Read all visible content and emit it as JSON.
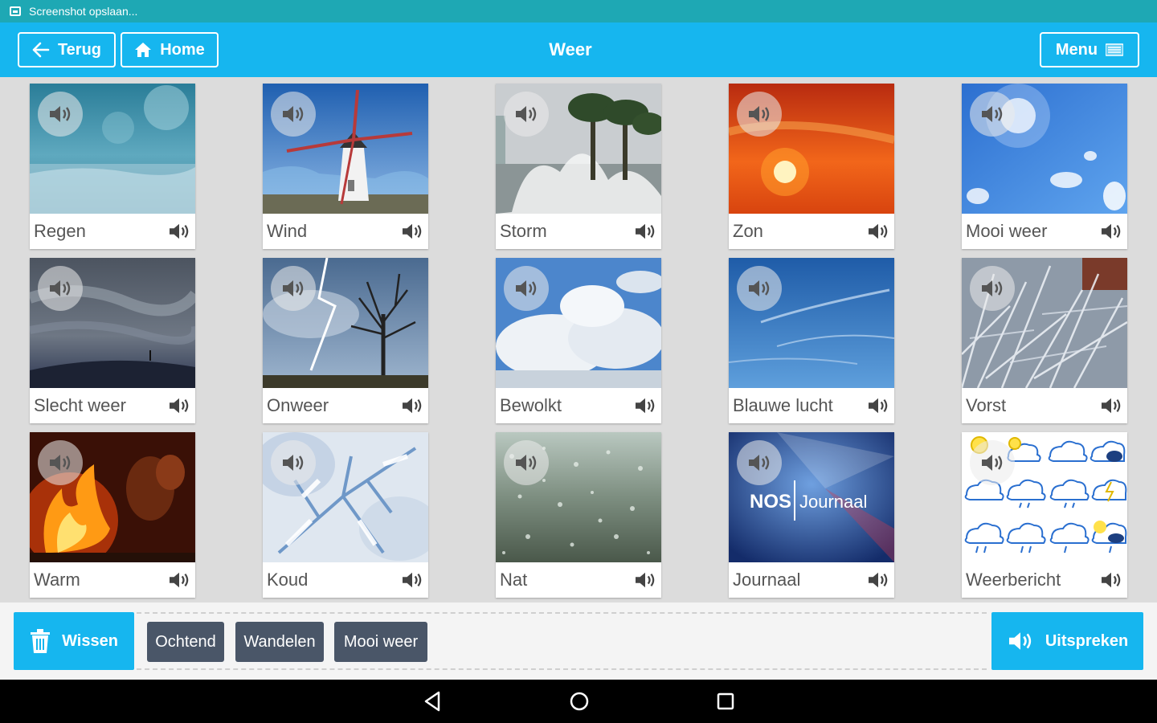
{
  "status_bar": {
    "notification": "Screenshot opslaan..."
  },
  "toolbar": {
    "back_label": "Terug",
    "home_label": "Home",
    "title": "Weer",
    "menu_label": "Menu"
  },
  "tiles": [
    {
      "label": "Regen",
      "photo": "rain"
    },
    {
      "label": "Wind",
      "photo": "windmill"
    },
    {
      "label": "Storm",
      "photo": "storm"
    },
    {
      "label": "Zon",
      "photo": "sun"
    },
    {
      "label": "Mooi weer",
      "photo": "nice-weather"
    },
    {
      "label": "Slecht weer",
      "photo": "bad-weather"
    },
    {
      "label": "Onweer",
      "photo": "thunderstorm"
    },
    {
      "label": "Bewolkt",
      "photo": "cloudy"
    },
    {
      "label": "Blauwe lucht",
      "photo": "blue-sky"
    },
    {
      "label": "Vorst",
      "photo": "frost"
    },
    {
      "label": "Warm",
      "photo": "campfire"
    },
    {
      "label": "Koud",
      "photo": "snowy-branch"
    },
    {
      "label": "Nat",
      "photo": "wet-window"
    },
    {
      "label": "Journaal",
      "photo": "news-logo",
      "logo_text": "NOS | Journaal"
    },
    {
      "label": "Weerbericht",
      "photo": "weather-icons"
    }
  ],
  "sentence": {
    "clear_label": "Wissen",
    "words": [
      "Ochtend",
      "Wandelen",
      "Mooi weer"
    ],
    "speak_label": "Uitspreken"
  },
  "colors": {
    "accent": "#16b6ef",
    "status_bar": "#1ea8b4",
    "chip": "#4a5668"
  }
}
